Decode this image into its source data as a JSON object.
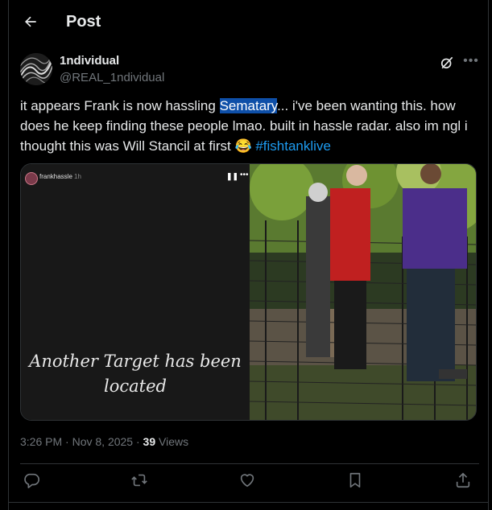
{
  "header": {
    "title": "Post"
  },
  "author": {
    "name": "1ndividual",
    "handle": "@REAL_1ndividual"
  },
  "post": {
    "text_before": "it appears Frank is now hassling ",
    "highlighted": "Sematary",
    "text_after": "... i've been wanting this. how does he keep finding these people lmao. built in hassle radar. also im ngl i thought this was Will Stancil at first ",
    "emoji": "😂",
    "hashtag": "#fishtanklive"
  },
  "media": {
    "story_user": "frankhassle",
    "story_time": "1h",
    "caption": "Another Target has been located"
  },
  "meta": {
    "time": "3:26 PM",
    "date": "Nov 8, 2025",
    "views_count": "39",
    "views_label": "Views"
  },
  "icons": {
    "back": "arrow-left-icon",
    "grok": "grok-icon",
    "more": "more-icon",
    "reply": "reply-icon",
    "repost": "repost-icon",
    "like": "heart-icon",
    "bookmark": "bookmark-icon",
    "share": "share-icon"
  },
  "colors": {
    "accent": "#1d9bf0",
    "highlight": "#0e4fa8",
    "muted": "#71767b"
  }
}
